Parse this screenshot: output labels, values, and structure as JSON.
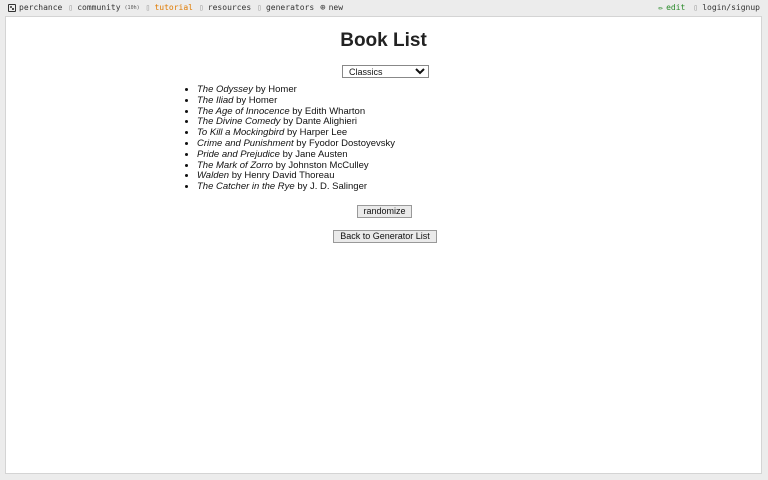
{
  "topbar": {
    "brand": "perchance",
    "nav": [
      {
        "label": "community",
        "extra": "(10h)",
        "icon": "users-icon"
      },
      {
        "label": "tutorial",
        "icon": "book-icon"
      },
      {
        "label": "resources",
        "icon": "folder-icon"
      },
      {
        "label": "generators",
        "icon": "list-icon"
      },
      {
        "label": "new",
        "icon": "plus-circle-icon"
      }
    ],
    "edit_label": "edit",
    "login_label": "login/signup"
  },
  "page": {
    "title": "Book List",
    "category_selected": "Classics",
    "randomize_label": "randomize",
    "back_label": "Back to Generator List"
  },
  "books": [
    {
      "title": "The Odyssey",
      "author": "by Homer"
    },
    {
      "title": "The Iliad",
      "author": "by Homer"
    },
    {
      "title": "The Age of Innocence",
      "author": "by Edith Wharton"
    },
    {
      "title": "The Divine Comedy",
      "author": "by Dante Alighieri"
    },
    {
      "title": "To Kill a Mockingbird",
      "author": "by Harper Lee"
    },
    {
      "title": "Crime and Punishment",
      "author": "by Fyodor Dostoyevsky"
    },
    {
      "title": "Pride and Prejudice",
      "author": "by Jane Austen"
    },
    {
      "title": "The Mark of Zorro",
      "author": "by Johnston McCulley"
    },
    {
      "title": "Walden",
      "author": "by Henry David Thoreau"
    },
    {
      "title": "The Catcher in the Rye",
      "author": "by J. D. Salinger"
    }
  ],
  "colors": {
    "tutorial": "#e07a00",
    "edit": "#2a8a2a",
    "background": "#ececec"
  }
}
